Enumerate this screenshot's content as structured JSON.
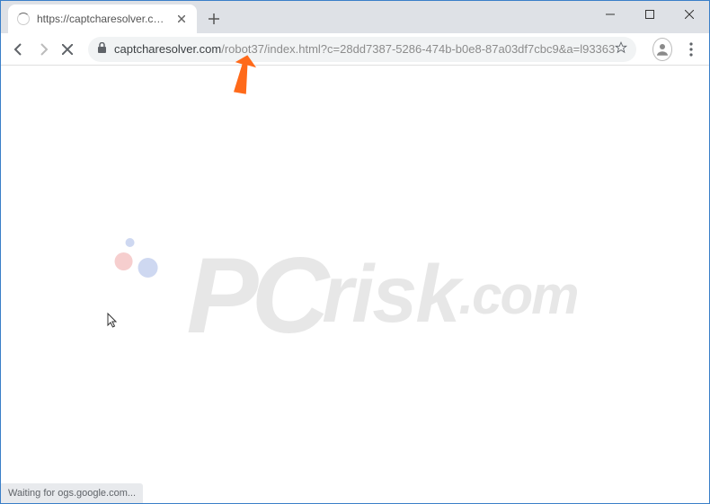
{
  "browser": {
    "tab": {
      "title": "https://captcharesolver.com/robo"
    },
    "url": {
      "domain": "captcharesolver.com",
      "path": "/robot37/index.html?c=28dd7387-5286-474b-b0e8-87a03df7cbc9&a=l93363"
    },
    "status_text": "Waiting for ogs.google.com..."
  },
  "watermark": {
    "prefix": "PC",
    "main": "risk",
    "suffix": ".com"
  }
}
